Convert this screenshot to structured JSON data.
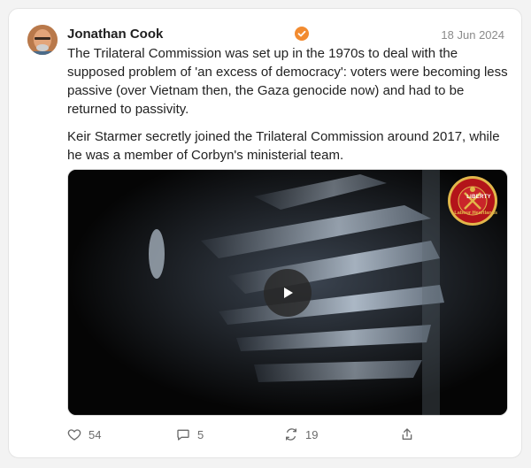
{
  "post": {
    "author": "Jonathan Cook",
    "date": "18 Jun 2024",
    "paragraphs": [
      "The Trilateral Commission was set up in the 1970s to deal with the supposed problem of 'an excess of democracy': voters were becoming less passive (over Vietnam then, the Gaza genocide now) and had to be returned to passivity.",
      "Keir Starmer secretly joined the Trilateral Commission around 2017, while he was a member of Corbyn's ministerial team."
    ],
    "video": {
      "badge_text_top": "LIBERTY",
      "badge_text_bottom": "Labour Heartlands"
    },
    "actions": {
      "likes": "54",
      "comments": "5",
      "restacks": "19"
    }
  },
  "colors": {
    "verified_badge": "#f28b30",
    "badge_red": "#b3141a",
    "badge_gold": "#e2b64a"
  },
  "icons": [
    "heart-icon",
    "comment-icon",
    "restack-icon",
    "share-icon",
    "play-icon",
    "verified-icon"
  ]
}
